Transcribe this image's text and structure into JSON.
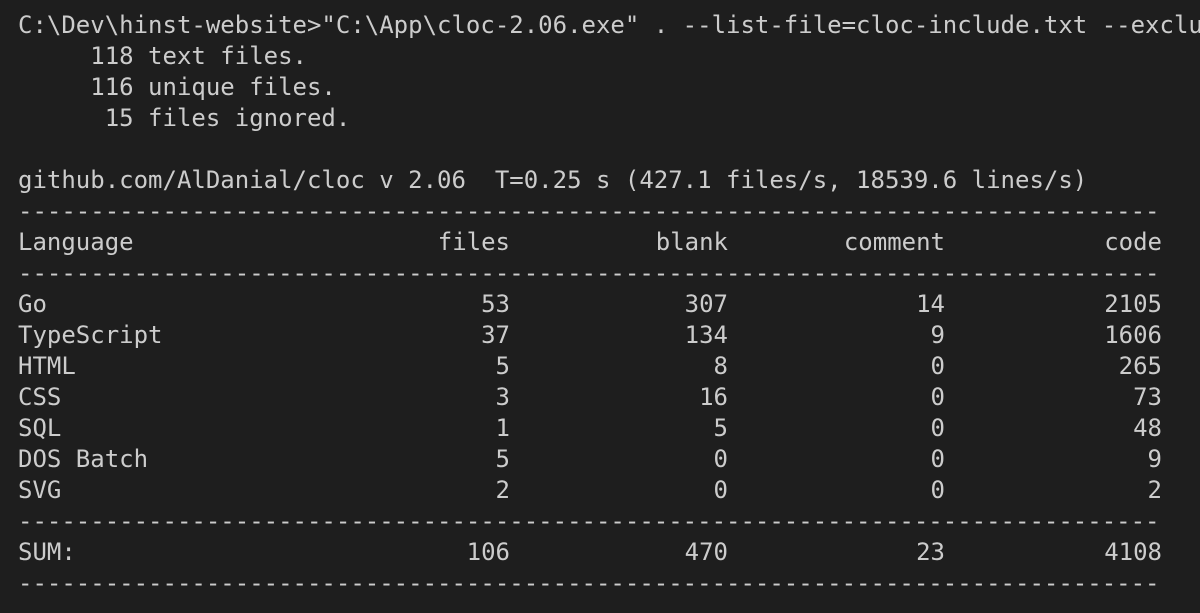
{
  "command": "C:\\Dev\\hinst-website>\"C:\\App\\cloc-2.06.exe\" . --list-file=cloc-include.txt --exclu",
  "summary": [
    "     118 text files.",
    "     116 unique files.",
    "      15 files ignored."
  ],
  "header_line": "github.com/AlDanial/cloc v 2.06  T=0.25 s (427.1 files/s, 18539.6 lines/s)",
  "separator": "-------------------------------------------------------------------------------",
  "columns": {
    "language": "Language",
    "files": "files",
    "blank": "blank",
    "comment": "comment",
    "code": "code"
  },
  "rows": [
    {
      "language": "Go",
      "files": "53",
      "blank": "307",
      "comment": "14",
      "code": "2105"
    },
    {
      "language": "TypeScript",
      "files": "37",
      "blank": "134",
      "comment": "9",
      "code": "1606"
    },
    {
      "language": "HTML",
      "files": "5",
      "blank": "8",
      "comment": "0",
      "code": "265"
    },
    {
      "language": "CSS",
      "files": "3",
      "blank": "16",
      "comment": "0",
      "code": "73"
    },
    {
      "language": "SQL",
      "files": "1",
      "blank": "5",
      "comment": "0",
      "code": "48"
    },
    {
      "language": "DOS Batch",
      "files": "5",
      "blank": "0",
      "comment": "0",
      "code": "9"
    },
    {
      "language": "SVG",
      "files": "2",
      "blank": "0",
      "comment": "0",
      "code": "2"
    }
  ],
  "sum": {
    "language": "SUM:",
    "files": "106",
    "blank": "470",
    "comment": "23",
    "code": "4108"
  },
  "colors": {
    "background": "#1e1e1e",
    "text": "#cccccc"
  }
}
